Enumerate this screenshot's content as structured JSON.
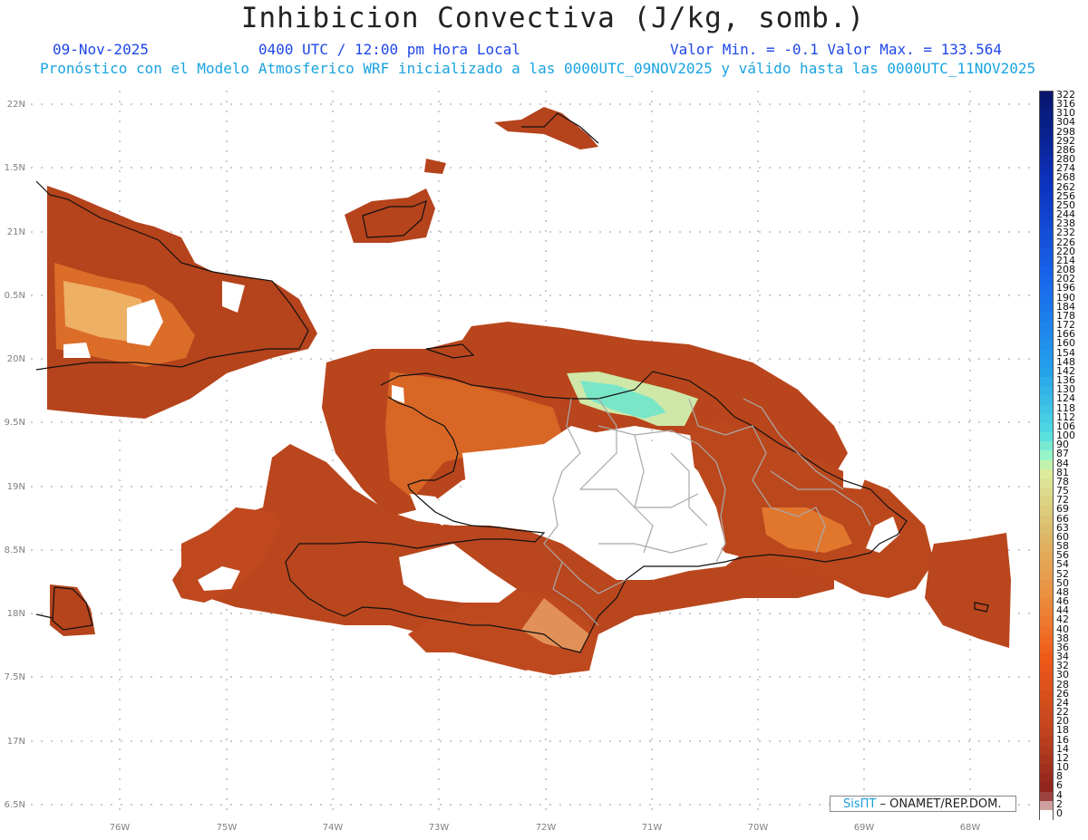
{
  "header": {
    "title": "Inhibicion Convectiva (J/kg, somb.)",
    "date": "09-Nov-2025",
    "time": "0400 UTC / 12:00 pm Hora Local",
    "value_range": "Valor Min. = -0.1  Valor Max. = 133.564",
    "subtitle": "Pronóstico con el Modelo Atmosferico WRF inicializado a las 0000UTC_09NOV2025 y válido hasta las  0000UTC_11NOV2025"
  },
  "axes": {
    "lat_labels": [
      "22N",
      "1.5N",
      "21N",
      "0.5N",
      "20N",
      "9.5N",
      "19N",
      "8.5N",
      "18N",
      "7.5N",
      "17N",
      "6.5N"
    ],
    "lon_labels": [
      "76W",
      "75W",
      "74W",
      "73W",
      "72W",
      "71W",
      "70W",
      "69W",
      "68W"
    ]
  },
  "colorbar": {
    "labels": [
      "322",
      "316",
      "310",
      "304",
      "298",
      "292",
      "286",
      "280",
      "274",
      "268",
      "262",
      "256",
      "250",
      "244",
      "238",
      "232",
      "226",
      "220",
      "214",
      "208",
      "202",
      "196",
      "190",
      "184",
      "178",
      "172",
      "166",
      "160",
      "154",
      "148",
      "142",
      "136",
      "130",
      "124",
      "118",
      "112",
      "106",
      "100",
      "90",
      "87",
      "84",
      "81",
      "78",
      "75",
      "72",
      "69",
      "66",
      "63",
      "60",
      "58",
      "56",
      "54",
      "52",
      "50",
      "48",
      "46",
      "44",
      "42",
      "40",
      "38",
      "36",
      "34",
      "32",
      "30",
      "28",
      "26",
      "24",
      "22",
      "20",
      "18",
      "16",
      "14",
      "12",
      "10",
      "8",
      "6",
      "4",
      "2",
      "0"
    ]
  },
  "credit": {
    "brand": "SisПТ",
    "org": "– ONAMET/REP.DOM."
  }
}
